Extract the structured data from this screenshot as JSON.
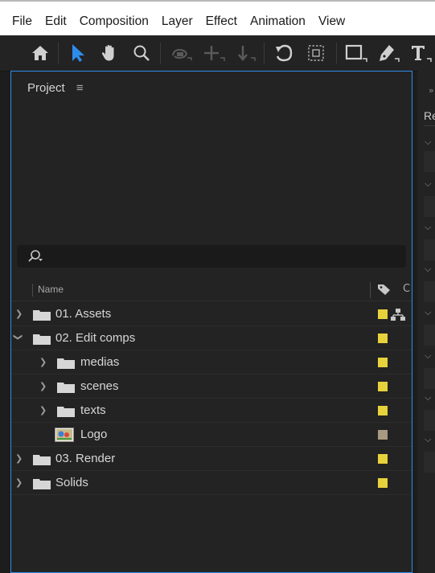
{
  "menubar": {
    "items": [
      "File",
      "Edit",
      "Composition",
      "Layer",
      "Effect",
      "Animation",
      "View"
    ]
  },
  "toolbar": {
    "tools": [
      "home-icon",
      "selection-arrow-icon",
      "hand-icon",
      "zoom-icon",
      "orbit-camera-icon",
      "pan-behind-icon",
      "dolly-icon",
      "rotation-icon",
      "region-icon",
      "rectangle-icon",
      "pen-icon",
      "type-icon"
    ],
    "accent": "#2d8ceb"
  },
  "project": {
    "tab_label": "Project",
    "search_placeholder": "",
    "columns": {
      "name": "Name",
      "second": "C"
    },
    "items": [
      {
        "label": "01. Assets",
        "type": "folder",
        "expanded": false,
        "depth": 0,
        "swatch": "#e8d23c"
      },
      {
        "label": "02. Edit comps",
        "type": "folder",
        "expanded": true,
        "depth": 0,
        "swatch": "#e8d23c"
      },
      {
        "label": "medias",
        "type": "folder",
        "expanded": false,
        "depth": 1,
        "swatch": "#e8d23c"
      },
      {
        "label": "scenes",
        "type": "folder",
        "expanded": false,
        "depth": 1,
        "swatch": "#e8d23c"
      },
      {
        "label": "texts",
        "type": "folder",
        "expanded": false,
        "depth": 1,
        "swatch": "#e8d23c"
      },
      {
        "label": "Logo",
        "type": "image",
        "expanded": false,
        "depth": 1,
        "swatch": "#a89a82"
      },
      {
        "label": "03. Render",
        "type": "folder",
        "expanded": false,
        "depth": 0,
        "swatch": "#e8d23c"
      },
      {
        "label": "Solids",
        "type": "folder",
        "expanded": false,
        "depth": 0,
        "swatch": "#e8d23c"
      }
    ]
  },
  "timeline": {
    "label_fragment": "Re"
  }
}
